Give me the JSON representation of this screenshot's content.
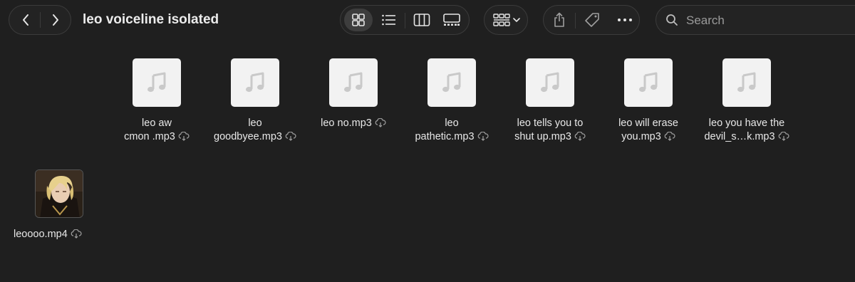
{
  "window": {
    "title": "leo voiceline isolated"
  },
  "toolbar": {
    "nav": {
      "back": "back",
      "forward": "forward"
    },
    "views": [
      "icon-view",
      "list-view",
      "column-view",
      "gallery-view"
    ],
    "selected_view": "icon-view",
    "group_menu": "group",
    "actions": [
      "share",
      "tag",
      "more"
    ]
  },
  "search": {
    "placeholder": "Search"
  },
  "files": [
    {
      "line1": "leo aw",
      "line2": "cmon .mp3",
      "kind": "audio",
      "status_icon": "cloud-download-icon"
    },
    {
      "line1": "leo",
      "line2": "goodbyee.mp3",
      "kind": "audio",
      "status_icon": "cloud-download-icon"
    },
    {
      "line1": "leo no.mp3",
      "line2": "",
      "kind": "audio",
      "status_icon": "cloud-download-icon"
    },
    {
      "line1": "leo",
      "line2": "pathetic.mp3",
      "kind": "audio",
      "status_icon": "cloud-download-icon"
    },
    {
      "line1": "leo tells you to",
      "line2": "shut up.mp3",
      "kind": "audio",
      "status_icon": "cloud-download-icon"
    },
    {
      "line1": "leo will erase",
      "line2": "you.mp3",
      "kind": "audio",
      "status_icon": "cloud-download-icon"
    },
    {
      "line1": "leo you have the",
      "line2": "devil_s…k.mp3",
      "kind": "audio",
      "status_icon": "cloud-download-icon"
    },
    {
      "line1": "leoooo.mp4",
      "line2": "",
      "kind": "video",
      "status_icon": "cloud-download-icon"
    }
  ],
  "colors": {
    "background": "#1f1f1f",
    "doc_icon": "#f2f2f2",
    "note_glyph": "#c9c9c9"
  }
}
